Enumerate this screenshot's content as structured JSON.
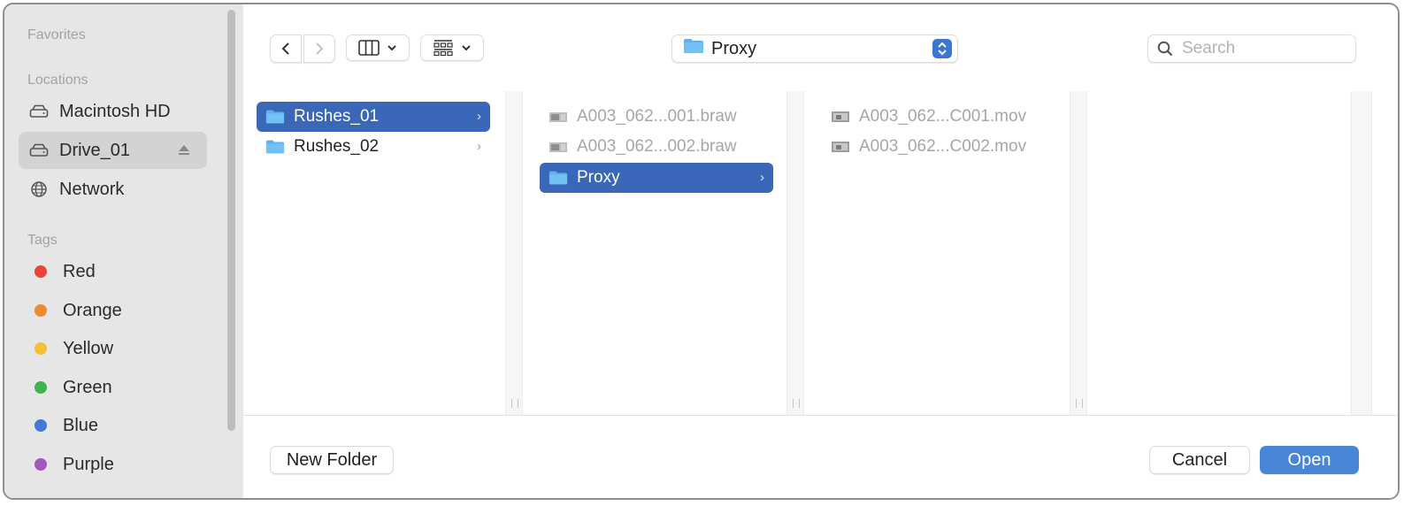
{
  "sidebar": {
    "favorites_label": "Favorites",
    "locations_label": "Locations",
    "locations": [
      {
        "label": "Macintosh HD",
        "icon": "disk-icon"
      },
      {
        "label": "Drive_01",
        "icon": "disk-icon",
        "selected": true
      },
      {
        "label": "Network",
        "icon": "globe-icon"
      }
    ],
    "tags_label": "Tags",
    "tags": [
      {
        "label": "Red",
        "color": "#e8443a"
      },
      {
        "label": "Orange",
        "color": "#ec8a33"
      },
      {
        "label": "Yellow",
        "color": "#f1c232"
      },
      {
        "label": "Green",
        "color": "#3fb34f"
      },
      {
        "label": "Blue",
        "color": "#4478d4"
      },
      {
        "label": "Purple",
        "color": "#a057c2"
      }
    ]
  },
  "toolbar": {
    "path_label": "Proxy",
    "search_placeholder": "Search"
  },
  "columns": [
    {
      "items": [
        {
          "label": "Rushes_01",
          "type": "folder",
          "selected": true,
          "chevron": true
        },
        {
          "label": "Rushes_02",
          "type": "folder",
          "selected": false,
          "chevron": true
        }
      ]
    },
    {
      "items": [
        {
          "label": "A003_062...001.braw",
          "type": "video",
          "dim": true
        },
        {
          "label": "A003_062...002.braw",
          "type": "video",
          "dim": true
        },
        {
          "label": "Proxy",
          "type": "folder",
          "selected": true,
          "chevron": true
        }
      ]
    },
    {
      "items": [
        {
          "label": "A003_062...C001.mov",
          "type": "video",
          "dim": true
        },
        {
          "label": "A003_062...C002.mov",
          "type": "video",
          "dim": true
        }
      ]
    }
  ],
  "footer": {
    "new_folder_label": "New Folder",
    "cancel_label": "Cancel",
    "open_label": "Open"
  },
  "colors": {
    "accent": "#3a67b8",
    "primary_button": "#4a86d6",
    "folder": "#5fb2ee"
  }
}
